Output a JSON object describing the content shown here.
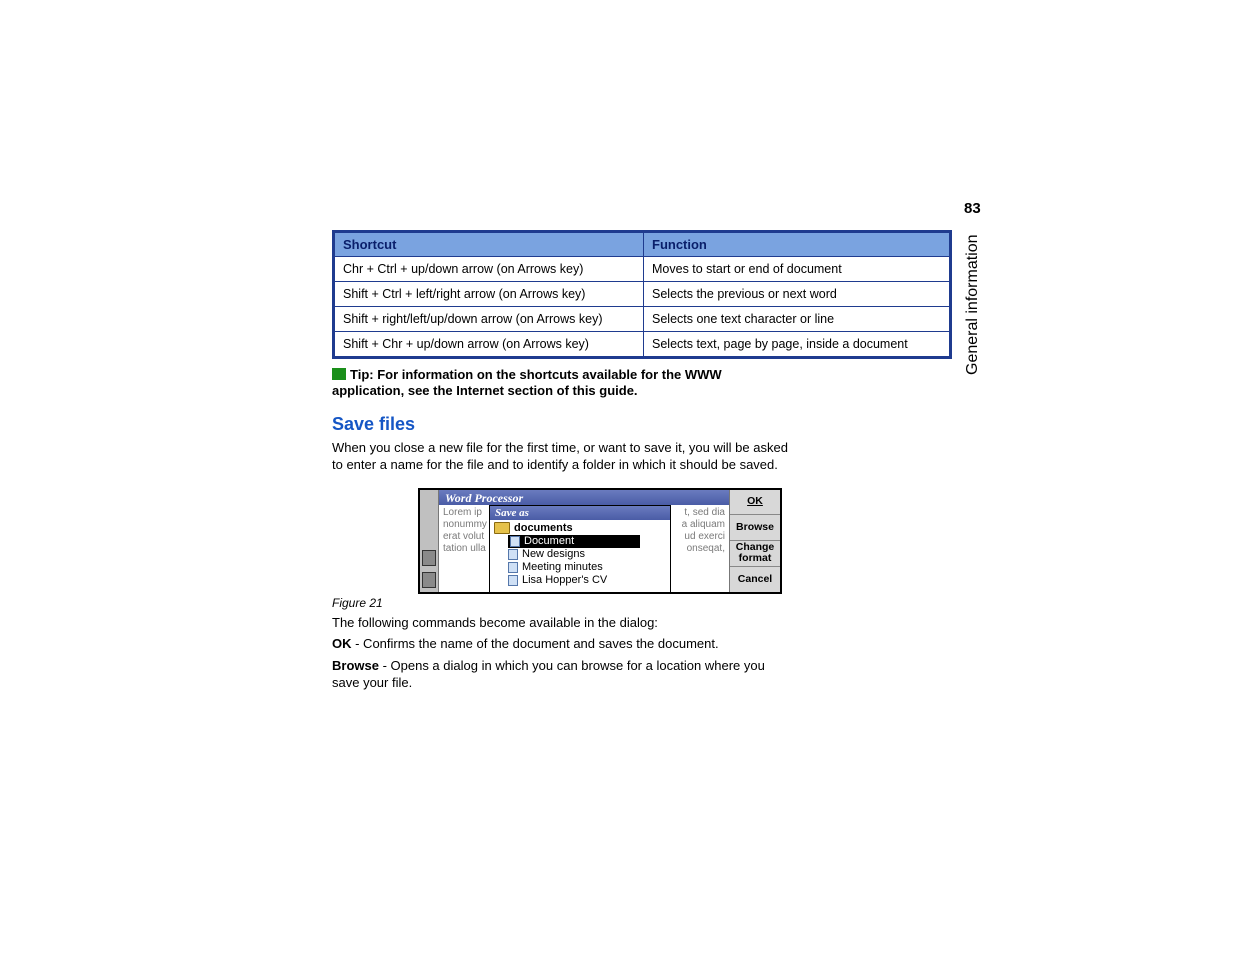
{
  "page_number": "83",
  "section_label": "General information",
  "table": {
    "headers": [
      "Shortcut",
      "Function"
    ],
    "rows": [
      [
        "Chr + Ctrl + up/down arrow (on Arrows key)",
        "Moves to start or end of document"
      ],
      [
        "Shift + Ctrl + left/right arrow (on Arrows key)",
        "Selects the previous or next word"
      ],
      [
        "Shift + right/left/up/down arrow (on Arrows key)",
        "Selects one text character or line"
      ],
      [
        "Shift + Chr + up/down arrow (on Arrows key)",
        "Selects text, page by page, inside a document"
      ]
    ]
  },
  "tip_text": "Tip: For information on the shortcuts available for the WWW application, see the Internet section of this guide.",
  "heading_save": "Save files",
  "save_intro": "When you close a new file for the first time, or want to save it, you will be asked to enter a name for the file and to identify a folder in which it should be saved.",
  "figure": {
    "caption": "Figure 21",
    "app_title": "Word Processor",
    "dialog_title": "Save as",
    "folder_label": "documents",
    "items": [
      "Document",
      "New designs",
      "Meeting minutes",
      "Lisa Hopper's CV"
    ],
    "buttons": [
      "OK",
      "Browse",
      "Change format",
      "Cancel"
    ],
    "lorem_left": [
      "Lorem ip",
      "nonummy",
      "erat volut",
      "tation ulla"
    ],
    "lorem_right": [
      "t, sed dia",
      "a aliquam",
      "ud exerci",
      "onseqat,"
    ]
  },
  "after_figure": "The following commands become available in the dialog:",
  "cmd_ok_label": "OK",
  "cmd_ok_text": " - Confirms the name of the document and saves the document.",
  "cmd_browse_label": "Browse",
  "cmd_browse_text": " - Opens a dialog in which you can browse for a location where you save your file."
}
